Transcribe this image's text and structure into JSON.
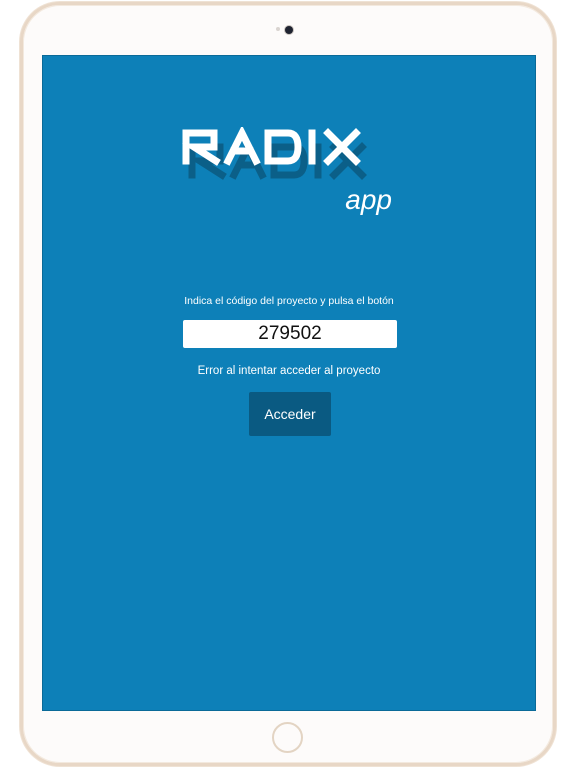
{
  "logo": {
    "wordmark": "RADIX",
    "subtitle": "app"
  },
  "login": {
    "prompt": "Indica el código del proyecto y pulsa el botón",
    "project_code": "279502",
    "error_message": "Error al intentar acceder al proyecto",
    "submit_label": "Acceder"
  },
  "colors": {
    "screen_background": "#0d80b8",
    "button_background": "#0a5a82",
    "text": "#ffffff",
    "device_frame": "#e8d7c6"
  }
}
